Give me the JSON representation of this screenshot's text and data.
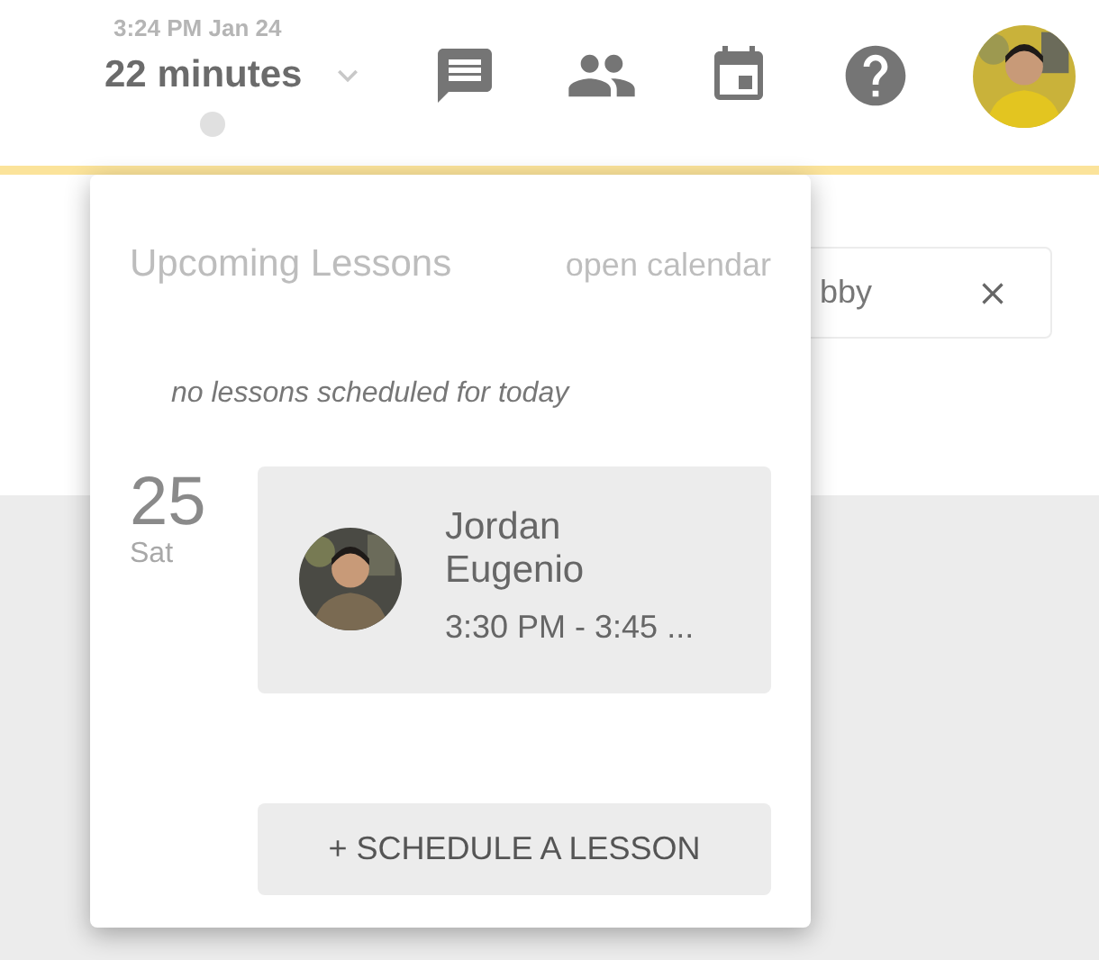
{
  "header": {
    "timestamp": "3:24 PM Jan 24",
    "duration": "22 minutes"
  },
  "background_field": {
    "value": "bby"
  },
  "popover": {
    "title": "Upcoming Lessons",
    "calendar_link": "open calendar",
    "empty_note": "no lessons scheduled for today",
    "days": [
      {
        "day": "25",
        "weekday": "Sat",
        "lessons": [
          {
            "name": "Jordan Eugenio",
            "time": "3:30 PM - 3:45 ..."
          }
        ]
      }
    ],
    "schedule_button": "+ SCHEDULE A LESSON"
  }
}
